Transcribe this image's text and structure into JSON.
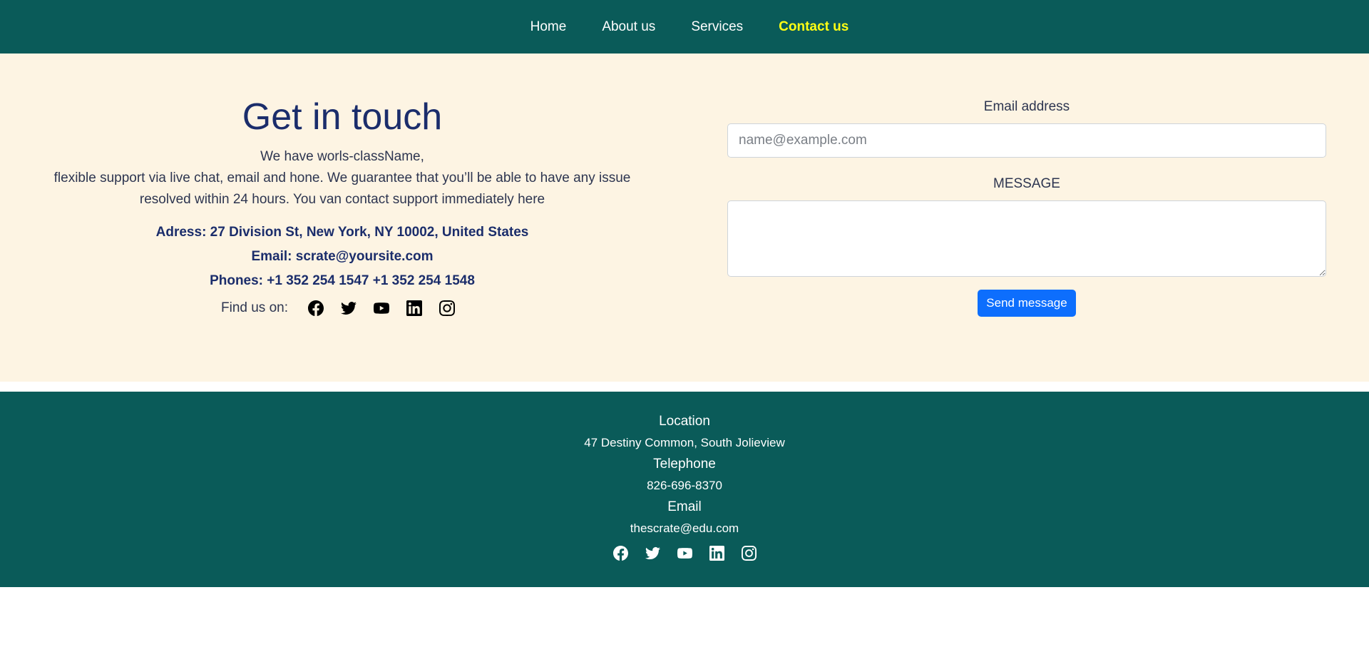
{
  "nav": {
    "items": [
      {
        "label": "Home",
        "active": false
      },
      {
        "label": "About us",
        "active": false
      },
      {
        "label": "Services",
        "active": false
      },
      {
        "label": "Contact us",
        "active": true
      }
    ]
  },
  "contact": {
    "title": "Get in touch",
    "intro_line1": "We have worls-className,",
    "intro_line2": "flexible support via live chat, email and hone. We guarantee that you’ll be able to have any issue resolved within 24 hours. You van contact support immediately here",
    "address": "Adress: 27 Division St, New York, NY 10002, United States",
    "email": "Email: scrate@yoursite.com",
    "phones": "Phones: +1 352 254 1547 +1 352 254 1548",
    "find_us_label": "Find us on:",
    "social_icons": [
      "facebook-icon",
      "twitter-icon",
      "youtube-icon",
      "linkedin-icon",
      "instagram-icon"
    ]
  },
  "form": {
    "email_label": "Email address",
    "email_placeholder": "name@example.com",
    "email_value": "",
    "message_label": "MESSAGE",
    "message_value": "",
    "send_label": "Send message"
  },
  "footer": {
    "location_heading": "Location",
    "location_value": "47 Destiny Common, South Jolieview",
    "telephone_heading": "Telephone",
    "telephone_value": "826-696-8370",
    "email_heading": "Email",
    "email_value": "thescrate@edu.com"
  },
  "colors": {
    "brand_teal": "#0a5b59",
    "section_bg": "#fdf4e3",
    "active_nav": "#ffff14",
    "heading": "#1b2d6b",
    "button": "#0d6efd"
  }
}
